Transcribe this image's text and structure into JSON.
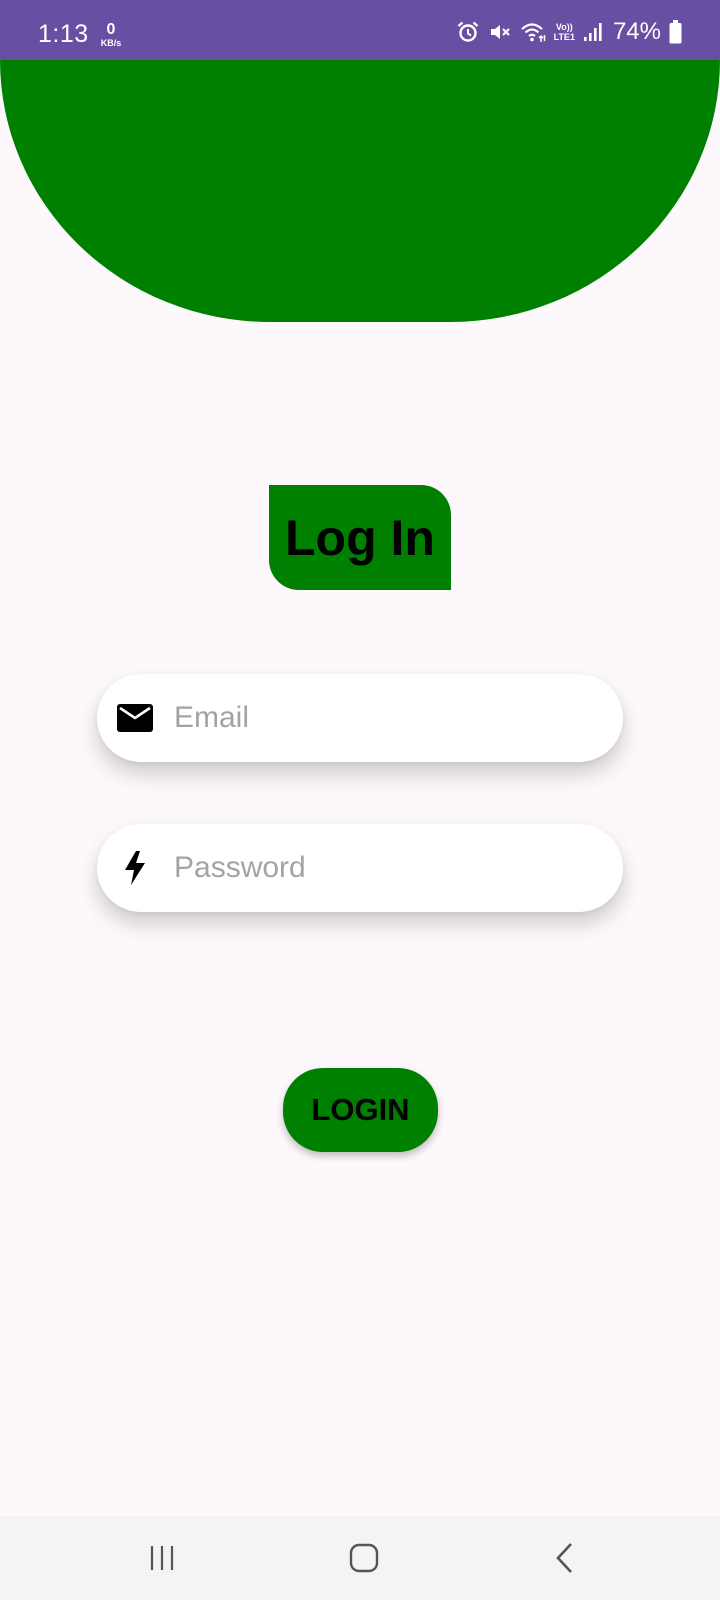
{
  "status_bar": {
    "time": "1:13",
    "net_speed_value": "0",
    "net_speed_unit": "KB/s",
    "volte_line1": "Vo))",
    "volte_line2": "LTE1",
    "battery_percent": "74%",
    "background_color": "#6750a4",
    "icons": [
      "alarm-icon",
      "mute-icon",
      "wifi-icon",
      "volte-icon",
      "signal-icon",
      "battery-icon"
    ]
  },
  "hero": {
    "color": "#008000"
  },
  "title": {
    "text": "Log In",
    "badge_color": "#008000"
  },
  "form": {
    "email": {
      "placeholder": "Email",
      "value": "",
      "icon": "mail-icon"
    },
    "password": {
      "placeholder": "Password",
      "value": "",
      "icon": "bolt-icon"
    }
  },
  "login_button": {
    "label": "LOGIN",
    "color": "#008000"
  },
  "nav_bar": {
    "buttons": [
      "recents-icon",
      "home-icon",
      "back-icon"
    ]
  }
}
